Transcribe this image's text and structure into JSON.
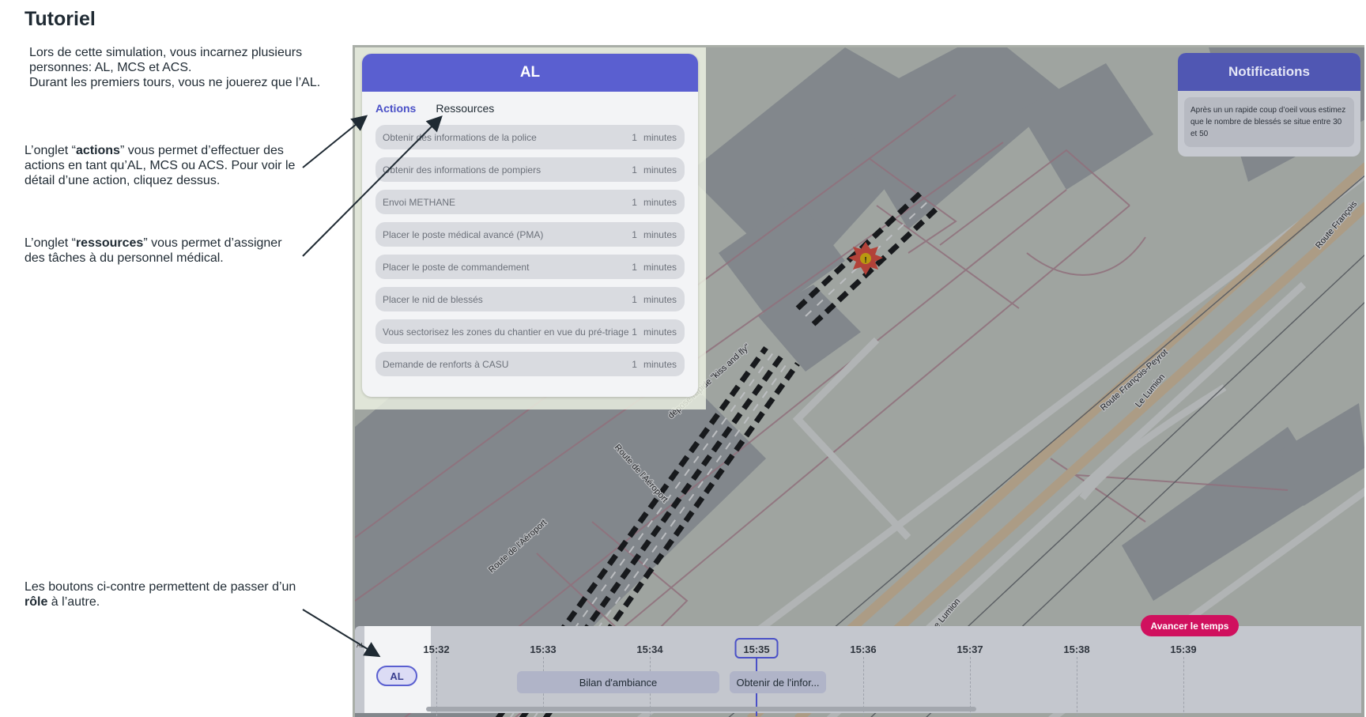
{
  "page": {
    "title": "Tutoriel",
    "intro": [
      "Lors de cette simulation, vous incarnez plusieurs",
      "personnes: AL, MCS et ACS.",
      "Durant les premiers tours, vous ne jouerez que l’AL."
    ],
    "tip_actions": {
      "pre": "L’onglet “",
      "bold": "actions",
      "post": "” vous permet d’effectuer des actions en tant qu’AL, MCS ou ACS. Pour voir le détail d’une action, cliquez dessus."
    },
    "tip_resources": {
      "pre": "L’onglet “",
      "bold": "ressources",
      "post": "” vous permet d’assigner des tâches à du personnel médical."
    },
    "tip_roles": {
      "pre": "Les boutons ci-contre permettent de passer d’un ",
      "bold": "rôle",
      "post": " à l’autre."
    }
  },
  "panel": {
    "title": "AL",
    "tabs": {
      "actions": "Actions",
      "resources": "Ressources"
    },
    "duration_unit": "minutes",
    "actions": [
      {
        "label": "Obtenir des informations de la police",
        "duration": "1"
      },
      {
        "label": "Obtenir des informations de pompiers",
        "duration": "1"
      },
      {
        "label": "Envoi METHANE",
        "duration": "1"
      },
      {
        "label": "Placer le poste médical avancé (PMA)",
        "duration": "1"
      },
      {
        "label": "Placer le poste de commandement",
        "duration": "1"
      },
      {
        "label": "Placer le nid de blessés",
        "duration": "1"
      },
      {
        "label": "Vous sectorisez les zones du chantier en vue du pré-triage",
        "duration": "1"
      },
      {
        "label": "Demande de renforts à CASU",
        "duration": "1"
      }
    ]
  },
  "notifications": {
    "title": "Notifications",
    "message": "Après un un rapide coup d’oeil vous estimez que le nombre de blessés se situe entre 30 et 50"
  },
  "map": {
    "labels": [
      "Route de l'Aéroport",
      "Route de l'Aéroport",
      "dépose rapide \"kiss and fly\"",
      "Route François-Peyrot",
      "Le Lumion",
      "Le Lumion",
      "Route François"
    ],
    "incident_marker": "!"
  },
  "timeline": {
    "role_label": "AL",
    "tiny_label": "AL",
    "ticks": [
      "15:32",
      "15:33",
      "15:34",
      "15:35",
      "15:36",
      "15:37",
      "15:38",
      "15:39"
    ],
    "current_time": "15:35",
    "events": [
      "Bilan d'ambiance",
      "Obtenir de l'infor..."
    ],
    "advance_button": "Avancer le temps"
  },
  "colors": {
    "accent": "#5a5fd0",
    "advance": "#d0105e",
    "notification_header": "#5057b3"
  }
}
